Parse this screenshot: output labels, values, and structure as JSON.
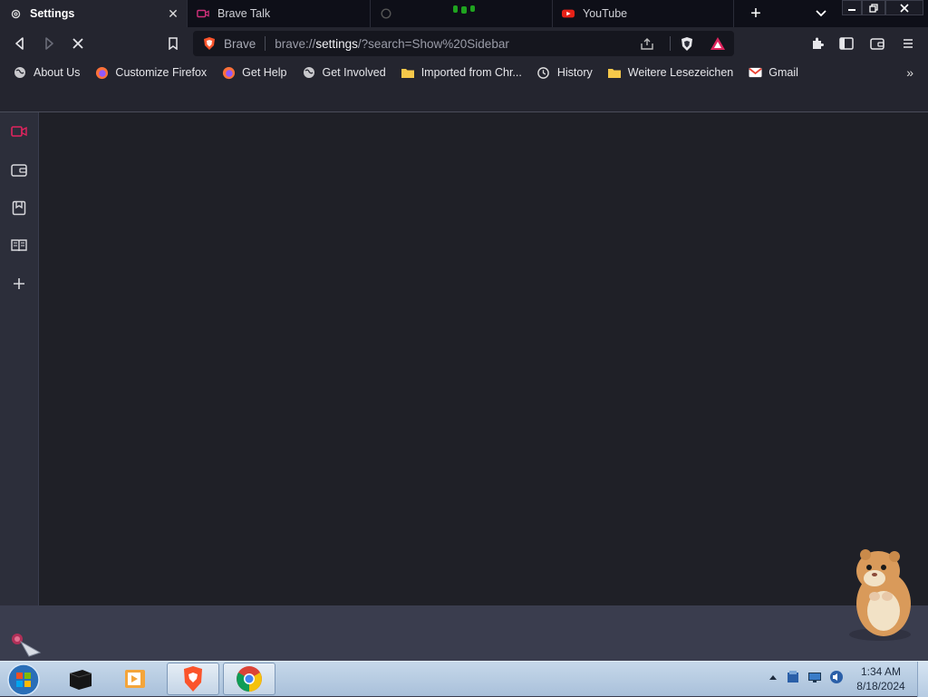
{
  "tabs": [
    {
      "label": "Settings",
      "active": true,
      "icon": "gear-icon"
    },
    {
      "label": "Brave Talk",
      "active": false,
      "icon": "video-camera-icon"
    },
    {
      "label": "",
      "active": false,
      "icon": "loading-icon"
    },
    {
      "label": "YouTube",
      "active": false,
      "icon": "youtube-icon"
    }
  ],
  "address": {
    "site_label": "Brave",
    "url_prefix": "brave://",
    "url_host": "settings",
    "url_rest": "/?search=Show%20Sidebar"
  },
  "bookmarks": [
    {
      "label": "About Us",
      "icon": "globe-icon"
    },
    {
      "label": "Customize Firefox",
      "icon": "firefox-icon"
    },
    {
      "label": "Get Help",
      "icon": "firefox-icon"
    },
    {
      "label": "Get Involved",
      "icon": "globe-icon"
    },
    {
      "label": "Imported from Chr...",
      "icon": "folder-icon"
    },
    {
      "label": "History",
      "icon": "history-icon"
    },
    {
      "label": "Weitere Lesezeichen",
      "icon": "folder-icon"
    },
    {
      "label": "Gmail",
      "icon": "gmail-icon"
    }
  ],
  "sidebar": [
    "brave-talk-icon",
    "wallet-icon",
    "bookmarks-icon",
    "reading-list-icon",
    "add-icon"
  ],
  "clock": {
    "time": "1:34 AM",
    "date": "8/18/2024"
  },
  "colors": {
    "accent": "#e0245e",
    "tab_bg": "#0e0f18",
    "toolbar_bg": "#24252f",
    "content_bg": "#1f2027",
    "taskbar": "#b4c9e0"
  }
}
